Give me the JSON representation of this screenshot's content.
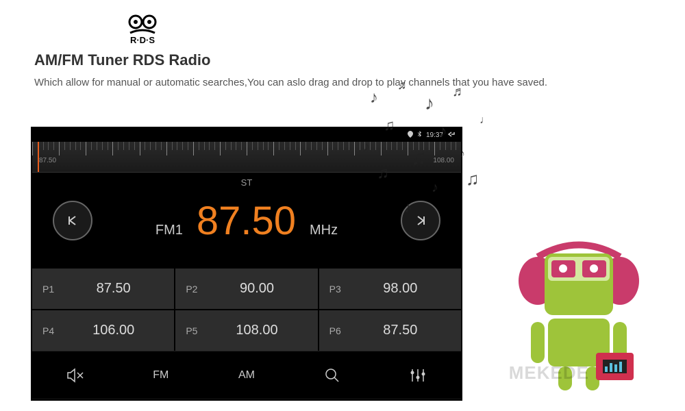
{
  "header": {
    "logo_text": "R·D·S",
    "title": "AM/FM Tuner RDS Radio",
    "description": "Which allow for manual or automatic searches,You can aslo drag and drop to play channels that you have saved."
  },
  "status": {
    "time": "19:37"
  },
  "dial": {
    "min": "87.50",
    "max": "108.00"
  },
  "tuner": {
    "st": "ST",
    "band": "FM1",
    "frequency": "87.50",
    "unit": "MHz"
  },
  "presets": [
    {
      "label": "P1",
      "value": "87.50"
    },
    {
      "label": "P2",
      "value": "90.00"
    },
    {
      "label": "P3",
      "value": "98.00"
    },
    {
      "label": "P4",
      "value": "106.00"
    },
    {
      "label": "P5",
      "value": "108.00"
    },
    {
      "label": "P6",
      "value": "87.50"
    }
  ],
  "bottom": {
    "fm": "FM",
    "am": "AM"
  },
  "watermark": "MEKEDE"
}
